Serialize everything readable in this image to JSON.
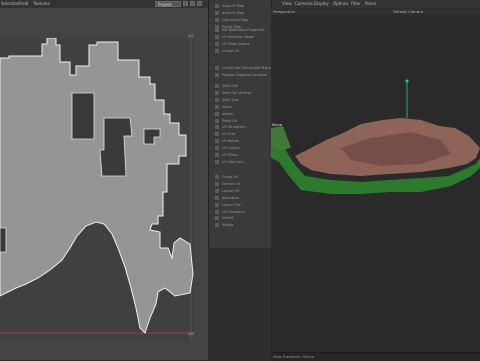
{
  "top_menu": {
    "left": [
      "Selection",
      "Field",
      "Textures"
    ],
    "right": [
      "View",
      "Cameras",
      "Display",
      "Options",
      "Filter",
      "Panel"
    ]
  },
  "uv_editor": {
    "mode_dropdown": "Project",
    "axis_top": "1.0",
    "axis_bottom": "1.0",
    "island_color": "#959595",
    "outline_color": "#f0f0f0"
  },
  "tool_panel": {
    "groups": [
      [
        "Auto UV Map",
        "Auto UV Map",
        "Cylindrical Map",
        "Planar Map"
      ],
      [
        "Set Wireframe Properties",
        "UV Selection Mode",
        "UV Show Seams",
        "Unfold UV"
      ],
      [
        "Unfold Use Triangulate Mapping",
        "Polygon Mapping Cameras"
      ],
      [
        "Shell Edit",
        "Shell Flip Vertical",
        "Shell Sew",
        "Stitch",
        "Attach",
        "Relax UV",
        "UV Straighten",
        "UV Grid",
        "UV Rotate",
        "UV Layout",
        "UV Mirror",
        "UV Map Sort"
      ],
      [
        "Group UV",
        "Extract UV",
        "Layout UV",
        "Normalize",
        "Layout Tile",
        "UV Transform",
        "Unfold",
        "Rotate"
      ]
    ]
  },
  "viewport": {
    "label_left": "Perspective",
    "label_right": "Default Camera",
    "side_label": "Move",
    "status_text": "View Transform: Scene",
    "terrain_colors": [
      "#9b6b5e",
      "#6f4a44",
      "#3f7a3a",
      "#1f6b1f"
    ]
  }
}
